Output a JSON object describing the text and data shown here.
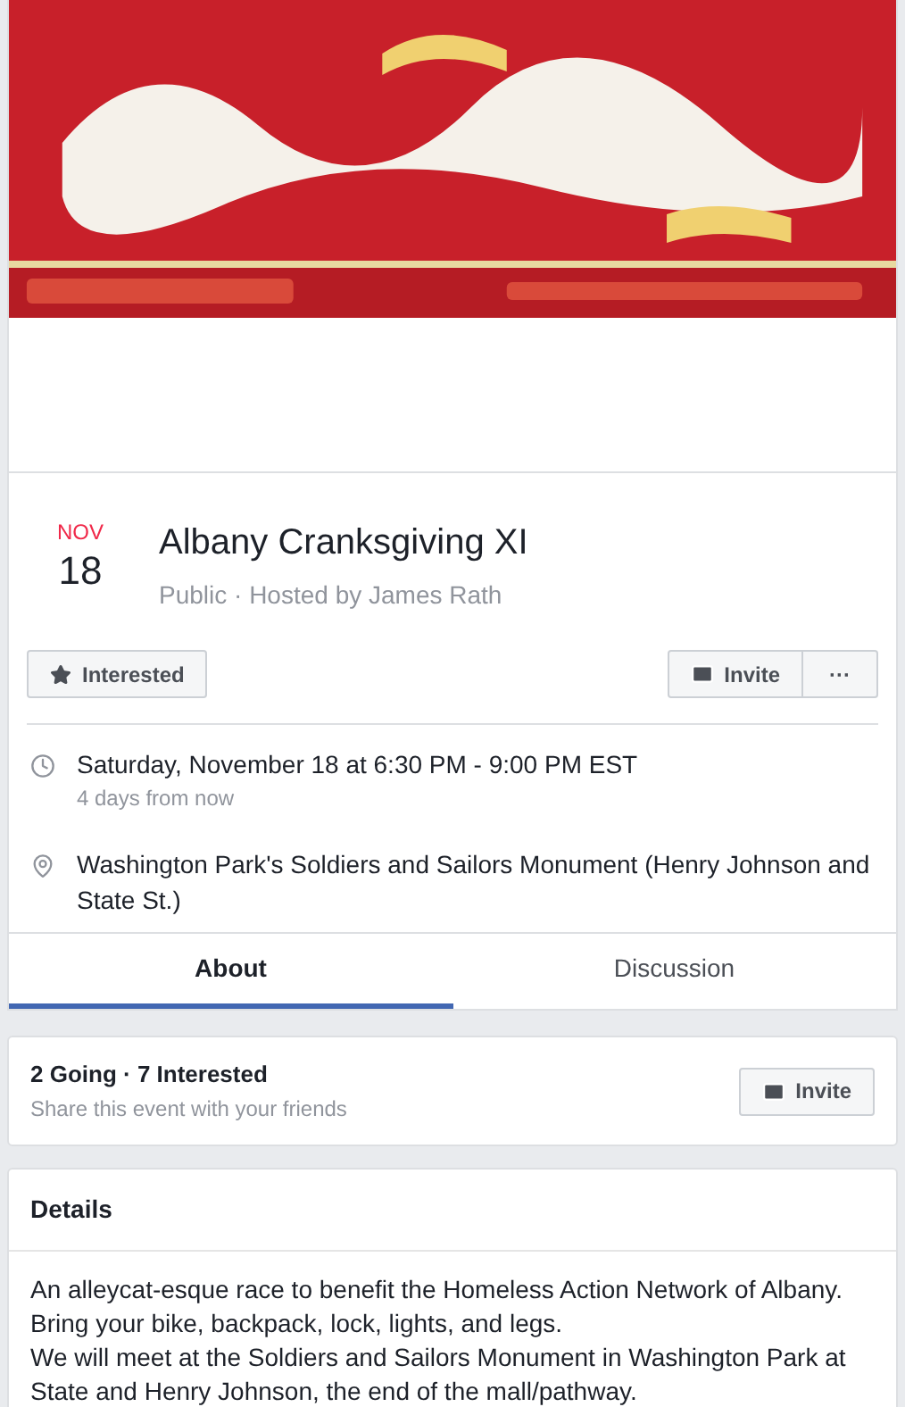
{
  "event": {
    "month": "NOV",
    "day": "18",
    "title": "Albany Cranksgiving XI",
    "subtitle": "Public · Hosted by James Rath"
  },
  "actions": {
    "interested": {
      "label": "Interested",
      "selected": false
    },
    "invite": "Invite",
    "more": "···"
  },
  "details_rows": [
    {
      "kind": "time",
      "text": "Saturday, November 18 at 6:30 PM - 9:00 PM EST",
      "sub": "4 days from now"
    },
    {
      "kind": "place",
      "text": "Washington Park's Soldiers and Sailors Monument (Henry Johnson and State St.)"
    }
  ],
  "tabs": [
    {
      "label": "About",
      "selected": true
    },
    {
      "label": "Discussion",
      "selected": false
    }
  ],
  "guests": {
    "summary": "2 Going · 7 Interested",
    "hint": "Share this event with your friends",
    "invite": "Invite"
  },
  "details": {
    "heading": "Details",
    "lines": [
      "An alleycat-esque race to benefit the Homeless Action Network of Albany.",
      "Bring your bike, backpack, lock, lights, and legs.",
      "We will meet at the Soldiers and Sailors Monument in Washington Park at State and Henry Johnson, the end of the mall/pathway."
    ]
  }
}
